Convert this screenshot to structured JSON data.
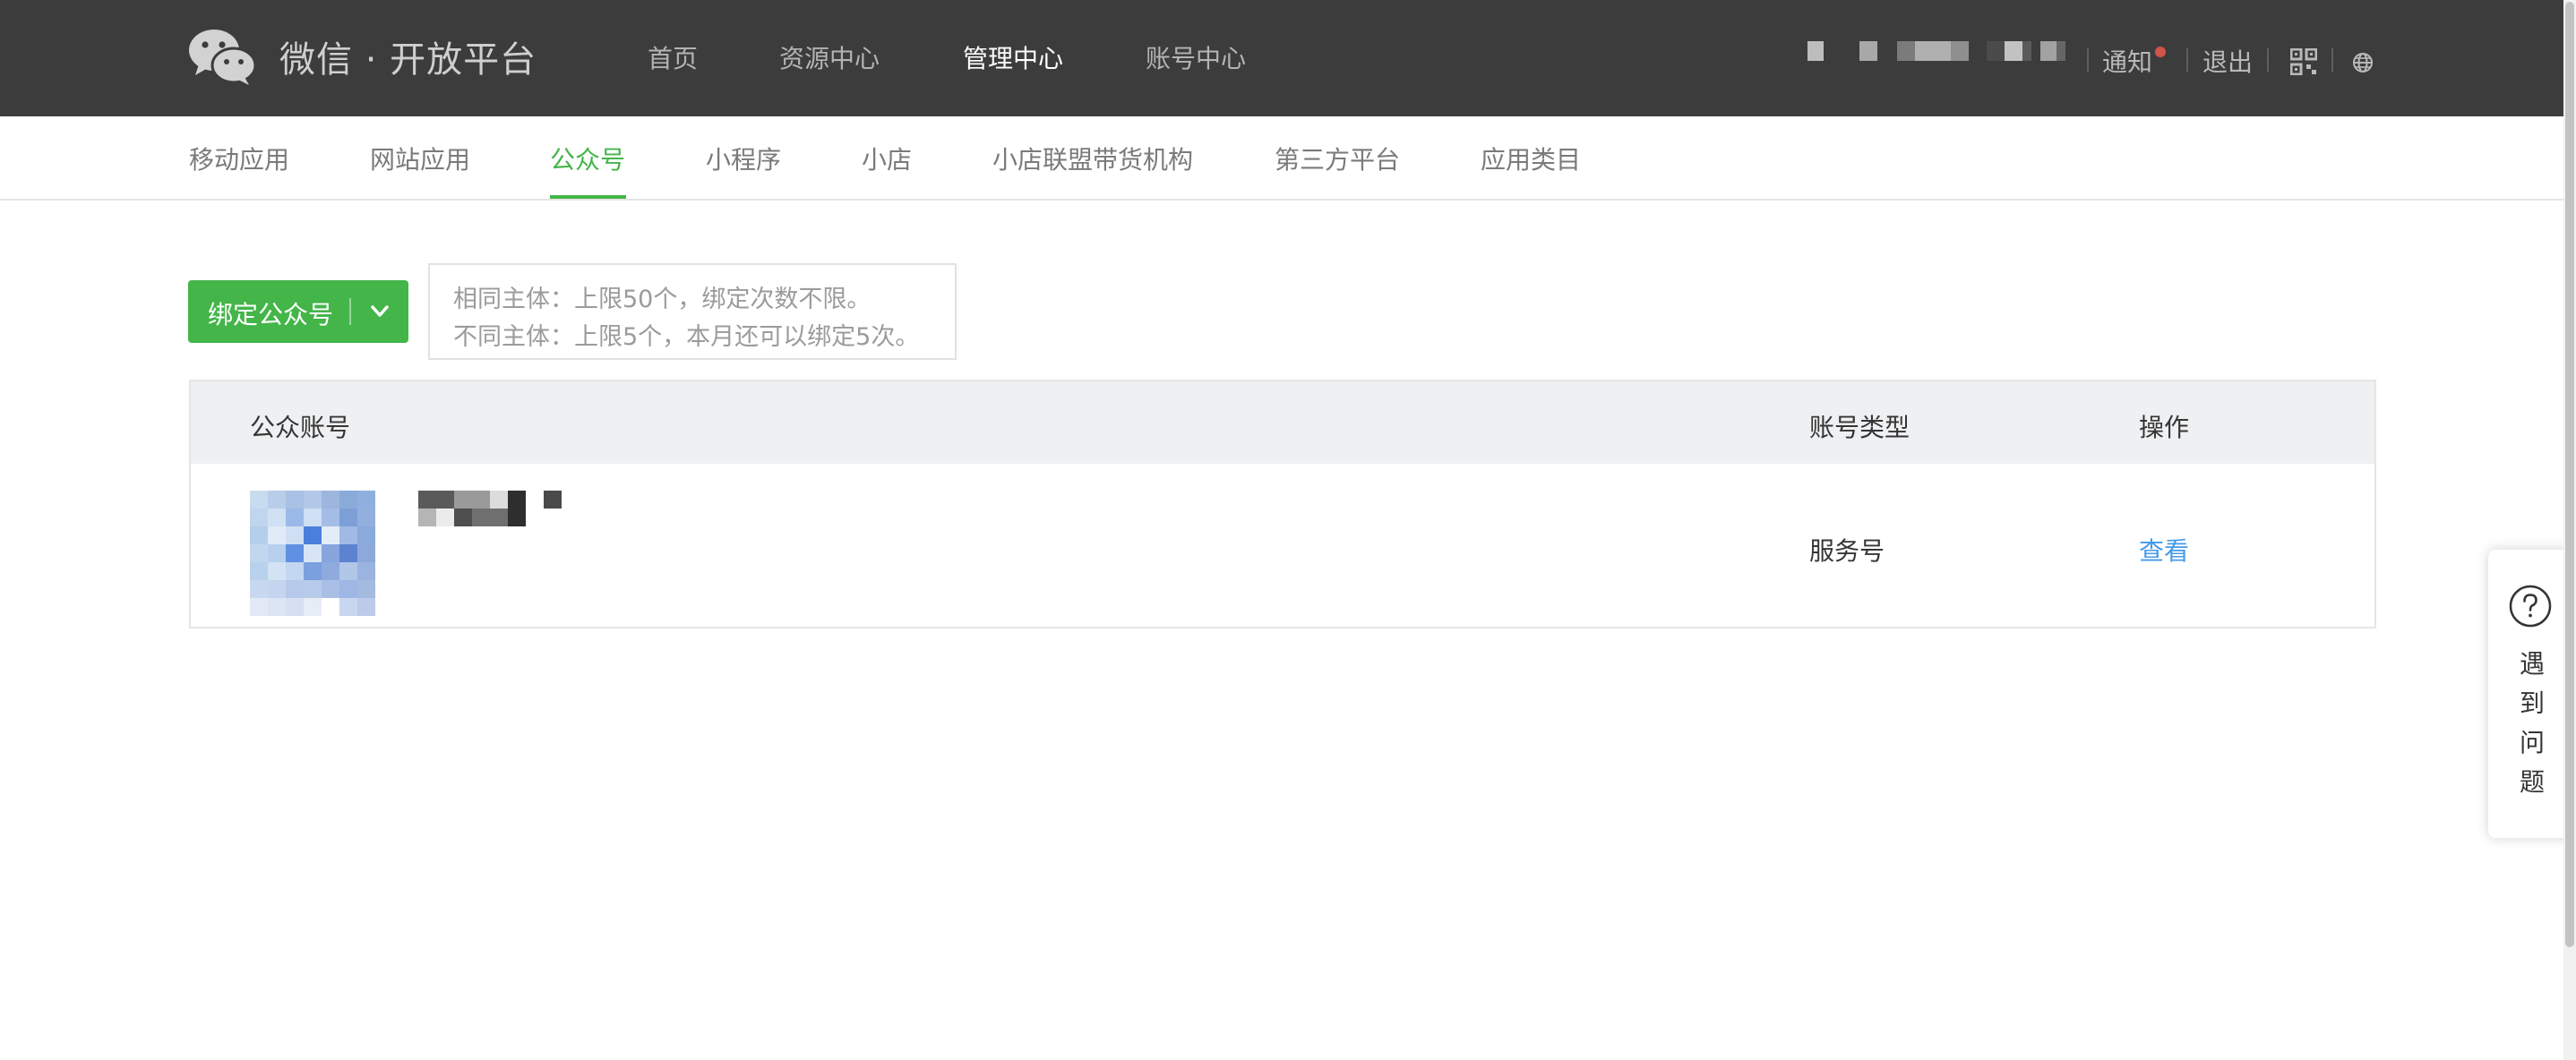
{
  "header": {
    "logo_text": "微信 · 开放平台",
    "nav": [
      {
        "label": "首页",
        "active": false
      },
      {
        "label": "资源中心",
        "active": false
      },
      {
        "label": "管理中心",
        "active": true
      },
      {
        "label": "账号中心",
        "active": false
      }
    ],
    "notice_label": "通知",
    "logout_label": "退出",
    "icons": [
      "wechat-logo",
      "qrcode-icon",
      "globe-icon"
    ]
  },
  "subnav": {
    "items": [
      {
        "label": "移动应用",
        "active": false
      },
      {
        "label": "网站应用",
        "active": false
      },
      {
        "label": "公众号",
        "active": true
      },
      {
        "label": "小程序",
        "active": false
      },
      {
        "label": "小店",
        "active": false
      },
      {
        "label": "小店联盟带货机构",
        "active": false
      },
      {
        "label": "第三方平台",
        "active": false
      },
      {
        "label": "应用类目",
        "active": false
      }
    ]
  },
  "actions": {
    "bind_button_label": "绑定公众号",
    "tip_lines": [
      "相同主体：上限50个，绑定次数不限。",
      "不同主体：上限5个，本月还可以绑定5次。"
    ]
  },
  "table": {
    "headers": [
      "公众账号",
      "账号类型",
      "操作"
    ],
    "rows": [
      {
        "account_type": "服务号",
        "action": "查看"
      }
    ]
  },
  "help": {
    "label": "遇到问题"
  },
  "colors": {
    "brand_green": "#44b549",
    "link_blue": "#459ae9",
    "topbar_bg": "#3c3c3c",
    "notice_dot": "#d35449"
  }
}
